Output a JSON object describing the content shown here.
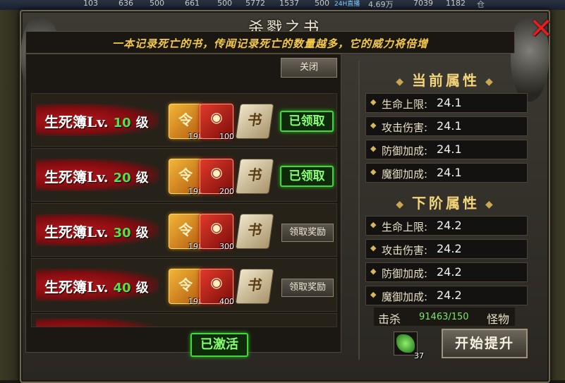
{
  "topbar": {
    "stats": [
      "103",
      "636",
      "500",
      "661",
      "500",
      "5772",
      "1537",
      "500",
      "24H直播",
      "4.69万",
      "7039",
      "1182"
    ],
    "corner_char": "仓"
  },
  "window": {
    "title": "杀戮之书",
    "subtitle": "一本记录死亡的书，传闻记录死亡的数量越多，它的威力将倍增",
    "close_button_label": "关闭"
  },
  "rows": [
    {
      "name": "生死簿",
      "lv_prefix": "Lv.",
      "level": "10",
      "unit": "级",
      "items": [
        {
          "count": "198"
        },
        {
          "count": "100"
        },
        {
          "count": ""
        }
      ],
      "status": "已领取"
    },
    {
      "name": "生死簿",
      "lv_prefix": "Lv.",
      "level": "20",
      "unit": "级",
      "items": [
        {
          "count": "198"
        },
        {
          "count": "200"
        },
        {
          "count": ""
        }
      ],
      "status": "已领取"
    },
    {
      "name": "生死簿",
      "lv_prefix": "Lv.",
      "level": "30",
      "unit": "级",
      "items": [
        {
          "count": "198"
        },
        {
          "count": "300"
        },
        {
          "count": ""
        }
      ],
      "status": "领取奖励"
    },
    {
      "name": "生死簿",
      "lv_prefix": "Lv.",
      "level": "40",
      "unit": "级",
      "items": [
        {
          "count": "198"
        },
        {
          "count": "400"
        },
        {
          "count": ""
        }
      ],
      "status": "领取奖励"
    }
  ],
  "activated_label": "已激活",
  "current": {
    "title": "当前属性",
    "attrs": [
      {
        "label": "生命上限:",
        "value": "24.1"
      },
      {
        "label": "攻击伤害:",
        "value": "24.1"
      },
      {
        "label": "防御加成:",
        "value": "24.1"
      },
      {
        "label": "魔御加成:",
        "value": "24.1"
      }
    ]
  },
  "next": {
    "title": "下阶属性",
    "attrs": [
      {
        "label": "生命上限:",
        "value": "24.2"
      },
      {
        "label": "攻击伤害:",
        "value": "24.2"
      },
      {
        "label": "防御加成:",
        "value": "24.2"
      },
      {
        "label": "魔御加成:",
        "value": "24.2"
      }
    ]
  },
  "kill": {
    "label": "击杀",
    "value": "91463/150",
    "suffix": "怪物"
  },
  "gem": {
    "count": "37"
  },
  "upgrade_label": "开始提升",
  "icons": {
    "close": "close-icon",
    "gold_item": "gold-token-icon",
    "red_item": "red-envelope-icon",
    "book_item": "book-icon",
    "gem": "green-gem-icon"
  },
  "colors": {
    "accent_gold": "#f4c94a",
    "claimed_green": "#3fd93a",
    "close_red": "#e02020"
  }
}
